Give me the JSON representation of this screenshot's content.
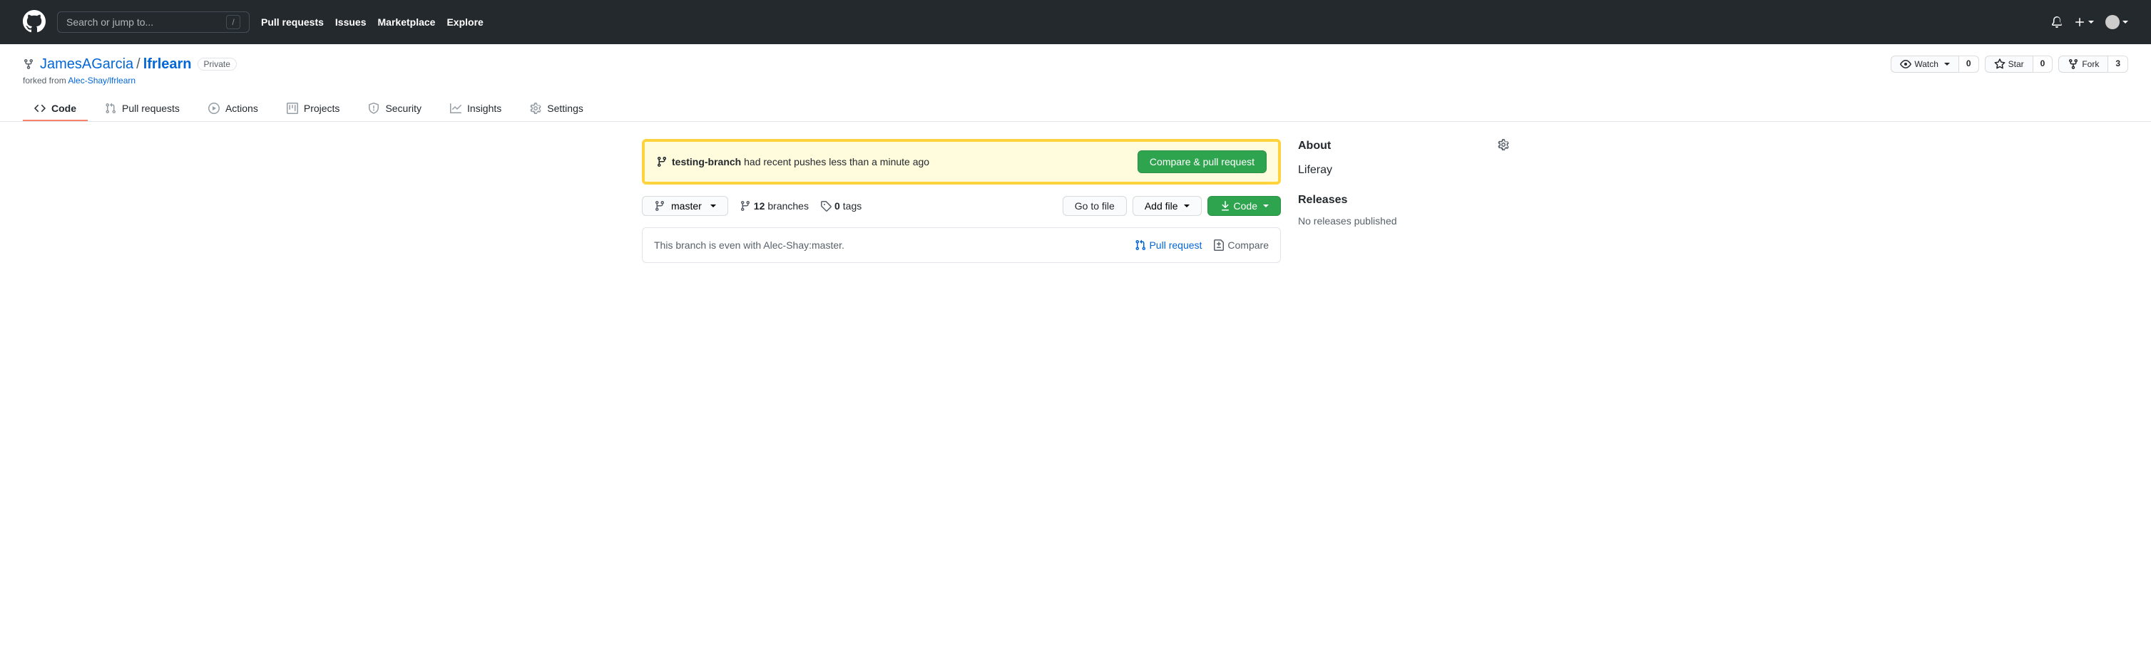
{
  "header": {
    "search_placeholder": "Search or jump to...",
    "nav": {
      "pull_requests": "Pull requests",
      "issues": "Issues",
      "marketplace": "Marketplace",
      "explore": "Explore"
    }
  },
  "repo": {
    "owner": "JamesAGarcia",
    "name": "lfrlearn",
    "visibility": "Private",
    "forked_from_label": "forked from ",
    "forked_from": "Alec-Shay/lfrlearn",
    "actions": {
      "watch_label": "Watch",
      "watch_count": "0",
      "star_label": "Star",
      "star_count": "0",
      "fork_label": "Fork",
      "fork_count": "3"
    }
  },
  "tabs": {
    "code": "Code",
    "pull_requests": "Pull requests",
    "actions": "Actions",
    "projects": "Projects",
    "security": "Security",
    "insights": "Insights",
    "settings": "Settings"
  },
  "alert": {
    "branch": "testing-branch",
    "message": " had recent pushes less than a minute ago",
    "button": "Compare & pull request"
  },
  "file_nav": {
    "branch": "master",
    "branches_count": "12",
    "branches_label": " branches",
    "tags_count": "0",
    "tags_label": " tags",
    "go_to_file": "Go to file",
    "add_file": "Add file",
    "code": "Code"
  },
  "even_box": {
    "text": "This branch is even with Alec-Shay:master.",
    "pull_request": "Pull request",
    "compare": "Compare"
  },
  "sidebar": {
    "about": {
      "title": "About",
      "description": "Liferay"
    },
    "releases": {
      "title": "Releases",
      "text": "No releases published"
    }
  }
}
